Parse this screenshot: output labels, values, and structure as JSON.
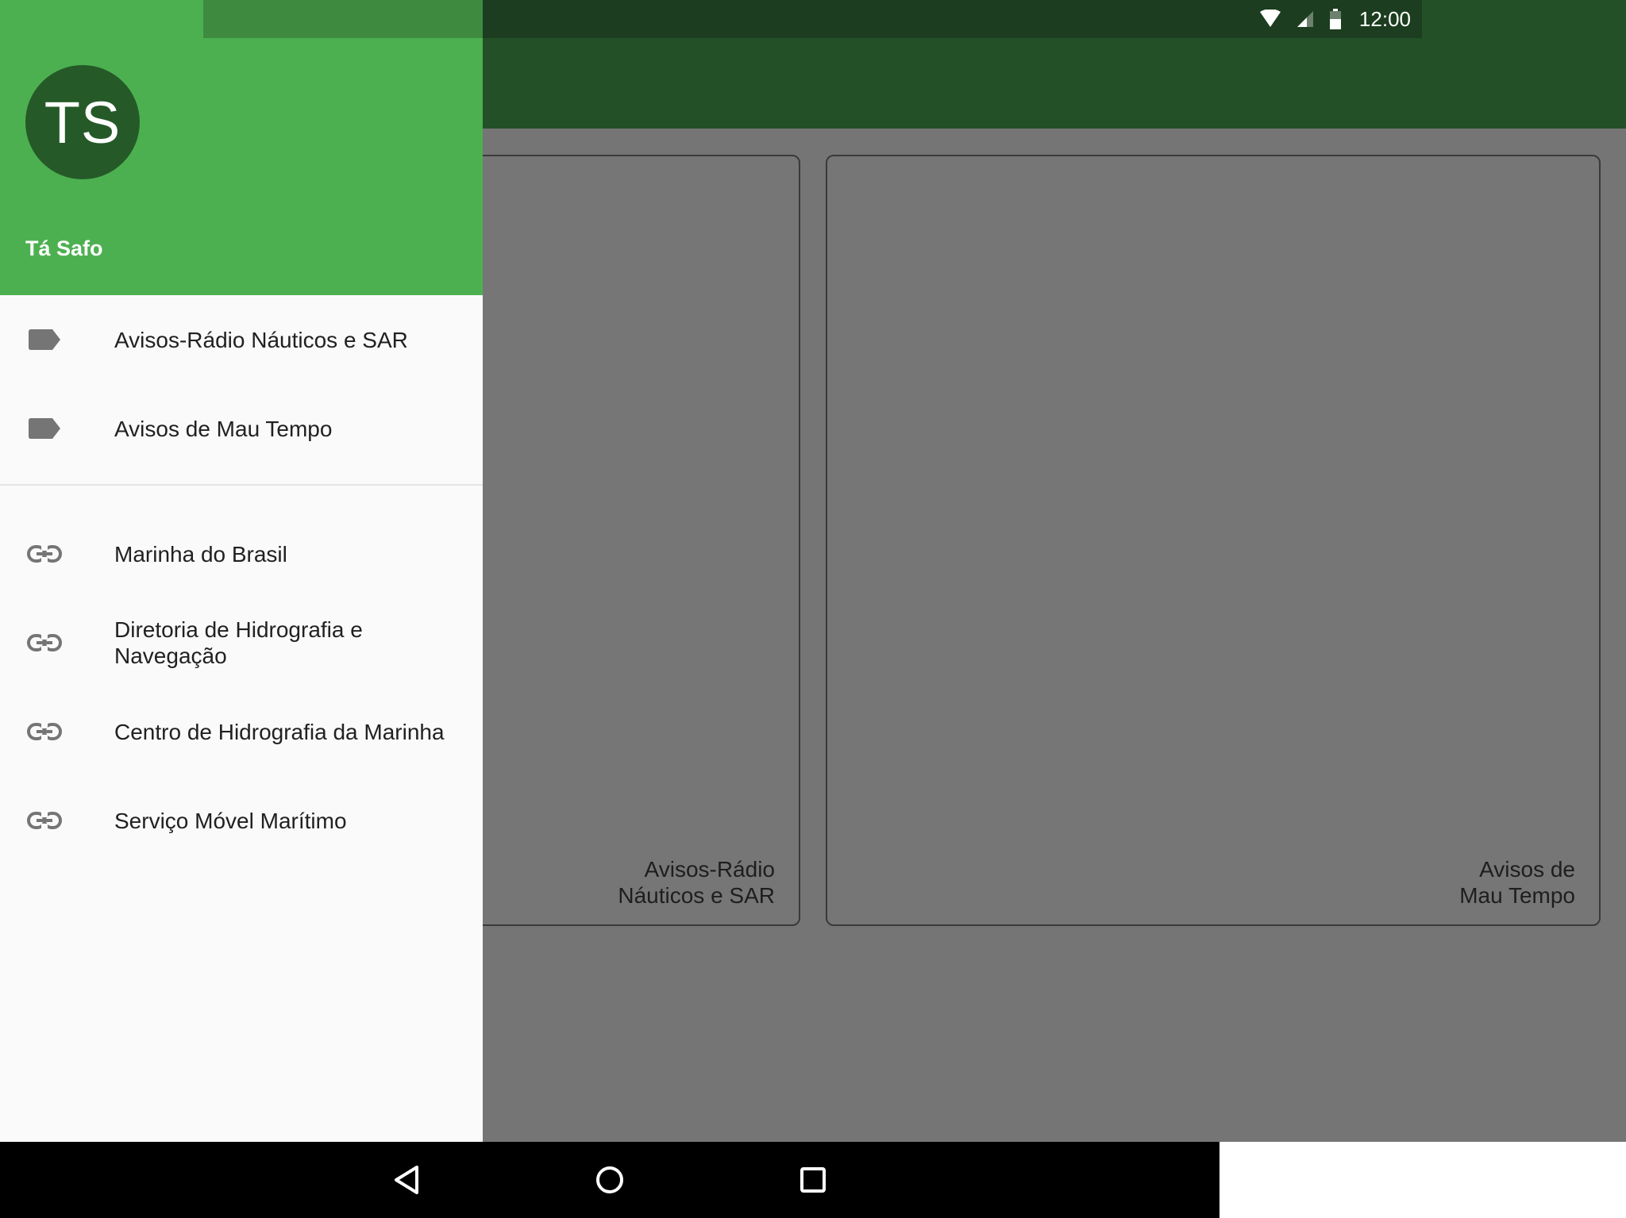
{
  "status_bar": {
    "time": "12:00",
    "icons": [
      "wifi-icon",
      "signal-icon",
      "battery-icon"
    ]
  },
  "drawer": {
    "avatar_initials": "TS",
    "account_name": "Tá Safo",
    "sections": [
      {
        "items": [
          {
            "label": "Avisos-Rádio Náuticos e SAR",
            "icon": "label-icon"
          },
          {
            "label": "Avisos de Mau Tempo",
            "icon": "label-icon"
          }
        ]
      },
      {
        "items": [
          {
            "label": "Marinha do Brasil",
            "icon": "link-icon"
          },
          {
            "label": "Diretoria de Hidrografia e Navegação",
            "icon": "link-icon"
          },
          {
            "label": "Centro de Hidrografia da Marinha",
            "icon": "link-icon"
          },
          {
            "label": "Serviço Móvel Marítimo",
            "icon": "link-icon"
          }
        ]
      }
    ]
  },
  "cards": [
    {
      "title_line1": "Avisos-Rádio",
      "title_line2": "Náuticos e SAR"
    },
    {
      "title_line1": "Avisos de",
      "title_line2": "Mau Tempo"
    }
  ],
  "colors": {
    "primary": "#4cb050",
    "primary_dark": "#235027",
    "avatar": "#255a28",
    "scrim": "#757575"
  }
}
